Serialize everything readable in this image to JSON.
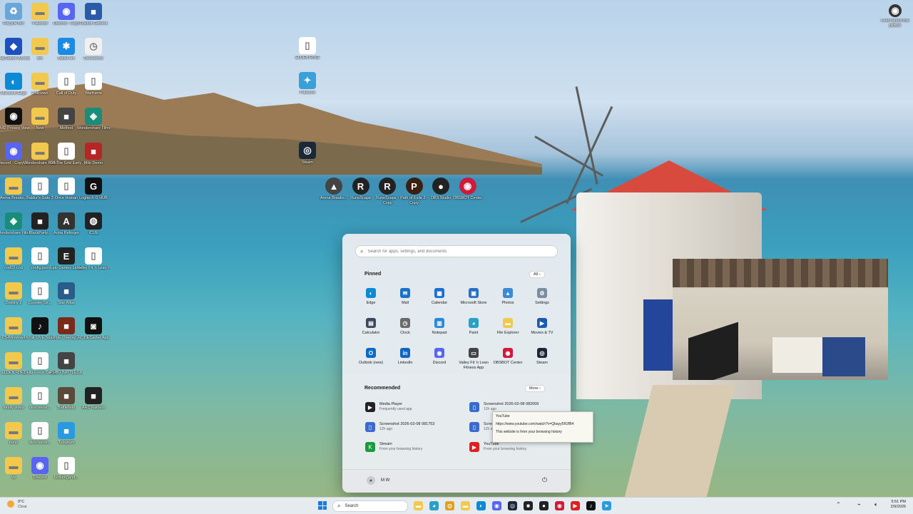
{
  "desktop_icons": [
    {
      "label": "Recycle Bin",
      "icon": "recycle-bin-icon",
      "color": "#6aa6d8"
    },
    {
      "label": "Palworld",
      "icon": "folder-icon",
      "color": "#f2c94c"
    },
    {
      "label": "Discord - Copy",
      "icon": "discord-icon",
      "color": "#5865f2"
    },
    {
      "label": "Obsbot Camera",
      "icon": "app-icon",
      "color": "#2b5aa8"
    },
    {
      "label": "PlayStation Accessories",
      "icon": "playstation-icon",
      "color": "#1f4fbf"
    },
    {
      "label": "bin",
      "icon": "folder-icon",
      "color": "#f2c94c"
    },
    {
      "label": "Battle.net",
      "icon": "battlenet-icon",
      "color": "#1b8ae0"
    },
    {
      "label": "Overlaerdo",
      "icon": "clock-icon",
      "color": "#f0f0f0"
    },
    {
      "label": "Microsoft Edge",
      "icon": "edge-icon",
      "color": "#0c8ad4"
    },
    {
      "label": "Unknown",
      "icon": "folder-icon",
      "color": "#f2c94c"
    },
    {
      "label": "Call of Duty",
      "icon": "file-icon",
      "color": "#ffffff"
    },
    {
      "label": "Warframe",
      "icon": "file-icon",
      "color": "#ffffff"
    },
    {
      "label": "AMD Privacy View",
      "icon": "eye-icon",
      "color": "#111111"
    },
    {
      "label": "New",
      "icon": "folder-icon",
      "color": "#f2c94c"
    },
    {
      "label": "Method",
      "icon": "app-icon",
      "color": "#444444"
    },
    {
      "label": "Wondershare Filmora 14",
      "icon": "filmora-icon",
      "color": "#1a8c7a"
    },
    {
      "label": "Discord - Copy (2)",
      "icon": "discord-icon",
      "color": "#5865f2"
    },
    {
      "label": "Wondershare FilmoraPro",
      "icon": "folder-icon",
      "color": "#f2c94c"
    },
    {
      "label": "Off The Grid Early Acce...",
      "icon": "file-icon",
      "color": "#ffffff"
    },
    {
      "label": "Milo Demo",
      "icon": "app-icon",
      "color": "#b52626"
    },
    {
      "label": "Arena Breako...",
      "icon": "folder-icon",
      "color": "#f2c94c"
    },
    {
      "label": "Baldur's Gate 3",
      "icon": "file-icon",
      "color": "#ffffff"
    },
    {
      "label": "Once Human",
      "icon": "file-icon",
      "color": "#ffffff"
    },
    {
      "label": "Logitech G HUB",
      "icon": "logitech-icon",
      "color": "#111111"
    },
    {
      "label": "Wondershare Filmora 14.1",
      "icon": "filmora-icon",
      "color": "#1a8c7a"
    },
    {
      "label": "BlackParty...",
      "icon": "app-icon",
      "color": "#222222"
    },
    {
      "label": "Arma Reforger",
      "icon": "arma-icon",
      "color": "#333333"
    },
    {
      "label": "iCUE",
      "icon": "icue-icon",
      "color": "#222222"
    },
    {
      "label": "cod22-cod",
      "icon": "folder-icon",
      "color": "#f2c94c"
    },
    {
      "label": "config.json",
      "icon": "file-icon",
      "color": "#ffffff"
    },
    {
      "label": "Epic Games Launcher",
      "icon": "epic-icon",
      "color": "#222222"
    },
    {
      "label": "Valley Fit 'n Lean Fitness...",
      "icon": "file-icon",
      "color": "#ffffff"
    },
    {
      "label": "Destiny 2",
      "icon": "folder-icon",
      "color": "#f2c94c"
    },
    {
      "label": "Counter-Str...",
      "icon": "file-icon",
      "color": "#ffffff"
    },
    {
      "label": "Star Atlas",
      "icon": "app-icon",
      "color": "#2a5c8a"
    },
    {
      "label": "",
      "icon": "",
      "color": ""
    },
    {
      "label": "DS4Windows",
      "icon": "folder-icon",
      "color": "#f2c94c"
    },
    {
      "label": "TikTok LIVE Studio",
      "icon": "tiktok-icon",
      "color": "#111111"
    },
    {
      "label": "PoE Overlay 2",
      "icon": "app-icon",
      "color": "#7a2a1a"
    },
    {
      "label": "RODECaster App",
      "icon": "rode-icon",
      "color": "#111111"
    },
    {
      "label": "ELDEN RING",
      "icon": "folder-icon",
      "color": "#f2c94c"
    },
    {
      "label": "Delta Force Demo",
      "icon": "file-icon",
      "color": "#ffffff"
    },
    {
      "label": "PUBG BATTLEGR...",
      "icon": "app-icon",
      "color": "#444444"
    },
    {
      "label": "",
      "icon": "",
      "color": ""
    },
    {
      "label": "family video",
      "icon": "folder-icon",
      "color": "#f2c94c"
    },
    {
      "label": "descreens...",
      "icon": "file-icon",
      "color": "#ffffff"
    },
    {
      "label": "Battlefield",
      "icon": "app-icon",
      "color": "#5a4a3a"
    },
    {
      "label": "ARC Raiders",
      "icon": "app-icon",
      "color": "#222222"
    },
    {
      "label": "mmo",
      "icon": "folder-icon",
      "color": "#f2c94c"
    },
    {
      "label": "descreens...",
      "icon": "file-icon",
      "color": "#ffffff"
    },
    {
      "label": "Telegram",
      "icon": "app-icon",
      "color": "#2a9ae0"
    },
    {
      "label": "",
      "icon": "",
      "color": ""
    },
    {
      "label": "vo",
      "icon": "folder-icon",
      "color": "#f2c94c"
    },
    {
      "label": "Discord",
      "icon": "discord-icon",
      "color": "#5865f2"
    },
    {
      "label": "broken_and...",
      "icon": "file-icon",
      "color": "#ffffff"
    }
  ],
  "extra_desktop_icons": [
    {
      "label": "ELDEN RING",
      "icon": "file-icon",
      "color": "#ffffff"
    },
    {
      "label": "Palworld",
      "icon": "palworld-icon",
      "color": "#3aa0d8"
    },
    {
      "label": "Steam",
      "icon": "steam-icon",
      "color": "#1b2838"
    }
  ],
  "shortcut_row": [
    {
      "label": "Arena Breako...",
      "icon": "arena-icon",
      "color": "#444444"
    },
    {
      "label": "RuneScape",
      "icon": "runescape-icon",
      "color": "#222222"
    },
    {
      "label": "RuneScape - Copy",
      "icon": "runescape-icon",
      "color": "#222222"
    },
    {
      "label": "Path of Exile 2 - Copy",
      "icon": "poe-icon",
      "color": "#3a2010"
    },
    {
      "label": "OBS Studio",
      "icon": "obs-icon",
      "color": "#222222"
    },
    {
      "label": "OBSBOT Center",
      "icon": "obsbot-icon",
      "color": "#d01a3a"
    }
  ],
  "top_right_icon": {
    "label": "Learn about this picture",
    "icon": "camera-icon"
  },
  "start_menu": {
    "search_placeholder": "Search for apps, settings, and documents",
    "pinned_title": "Pinned",
    "all_button": "All",
    "pinned": [
      {
        "label": "Edge",
        "icon": "edge-icon",
        "color": "#0c8ad4"
      },
      {
        "label": "Mail",
        "icon": "mail-icon",
        "color": "#1a72c8"
      },
      {
        "label": "Calendar",
        "icon": "calendar-icon",
        "color": "#1a6fd0"
      },
      {
        "label": "Microsoft Store",
        "icon": "store-icon",
        "color": "#2670c6"
      },
      {
        "label": "Photos",
        "icon": "photos-icon",
        "color": "#3a8ad8"
      },
      {
        "label": "Settings",
        "icon": "settings-icon",
        "color": "#7a8ca0"
      },
      {
        "label": "Calculator",
        "icon": "calculator-icon",
        "color": "#3a4a5c"
      },
      {
        "label": "Clock",
        "icon": "clock-icon",
        "color": "#6a6a6a"
      },
      {
        "label": "Notepad",
        "icon": "notepad-icon",
        "color": "#2a88d8"
      },
      {
        "label": "Paint",
        "icon": "paint-icon",
        "color": "#2aa0c8"
      },
      {
        "label": "File Explorer",
        "icon": "folder-icon",
        "color": "#f2c94c"
      },
      {
        "label": "Movies & TV",
        "icon": "movies-icon",
        "color": "#1a5ab0"
      },
      {
        "label": "Outlook (new)",
        "icon": "outlook-icon",
        "color": "#0a6ac8"
      },
      {
        "label": "LinkedIn",
        "icon": "linkedin-icon",
        "color": "#0a66c2"
      },
      {
        "label": "Discord",
        "icon": "discord-icon",
        "color": "#5865f2"
      },
      {
        "label": "Valley Fit 'n Lean Fitness App",
        "icon": "fitness-icon",
        "color": "#444444"
      },
      {
        "label": "OBSBOT Center",
        "icon": "obsbot-icon",
        "color": "#d01a3a"
      },
      {
        "label": "Steam",
        "icon": "steam-icon",
        "color": "#1b2838"
      }
    ],
    "recommended_title": "Recommended",
    "more_button": "More",
    "recommended": [
      {
        "title": "Media Player",
        "subtitle": "Frequently used app",
        "icon": "media-player-icon",
        "color": "#222222"
      },
      {
        "title": "Screenshot 2026-02-08 082009",
        "subtitle": "12h ago",
        "icon": "file-icon",
        "color": "#3a6ad0"
      },
      {
        "title": "Screenshot 2026-02-08 081753",
        "subtitle": "12h ago",
        "icon": "file-icon",
        "color": "#3a6ad0"
      },
      {
        "title": "Screenshot 2026-02-08 081...",
        "subtitle": "12h ago",
        "icon": "file-icon",
        "color": "#3a6ad0"
      },
      {
        "title": "Stream",
        "subtitle": "From your browsing history",
        "icon": "stream-icon",
        "color": "#1a9a3a"
      },
      {
        "title": "YouTube",
        "subtitle": "From your browsing history",
        "icon": "youtube-icon",
        "color": "#e02020"
      }
    ],
    "tooltip": {
      "title": "YouTube",
      "url": "https://www.youtube.com/watch?v=Qbayy5R2fB4",
      "note": "This website is from your browsing history"
    },
    "user_name": "M W"
  },
  "taskbar": {
    "search_label": "Search",
    "weather_temp": "0°C",
    "weather_desc": "Clear",
    "time": "5:51 PM",
    "date": "2/9/2026",
    "apps": [
      {
        "icon": "file-explorer-icon",
        "color": "#f2c94c"
      },
      {
        "icon": "paint-icon",
        "color": "#2aa0c8"
      },
      {
        "icon": "chrome-icon",
        "color": "#e0a020"
      },
      {
        "icon": "folder-icon",
        "color": "#f2c94c"
      },
      {
        "icon": "edge-icon",
        "color": "#0c8ad4"
      },
      {
        "icon": "discord-icon",
        "color": "#5865f2"
      },
      {
        "icon": "steam-icon",
        "color": "#1b2838"
      },
      {
        "icon": "app-icon",
        "color": "#222222"
      },
      {
        "icon": "obs-icon",
        "color": "#222222"
      },
      {
        "icon": "obsbot-icon",
        "color": "#d01a3a"
      },
      {
        "icon": "youtube-icon",
        "color": "#e02020"
      },
      {
        "icon": "tiktok-icon",
        "color": "#111111"
      },
      {
        "icon": "telegram-icon",
        "color": "#2a9ae0"
      }
    ]
  }
}
